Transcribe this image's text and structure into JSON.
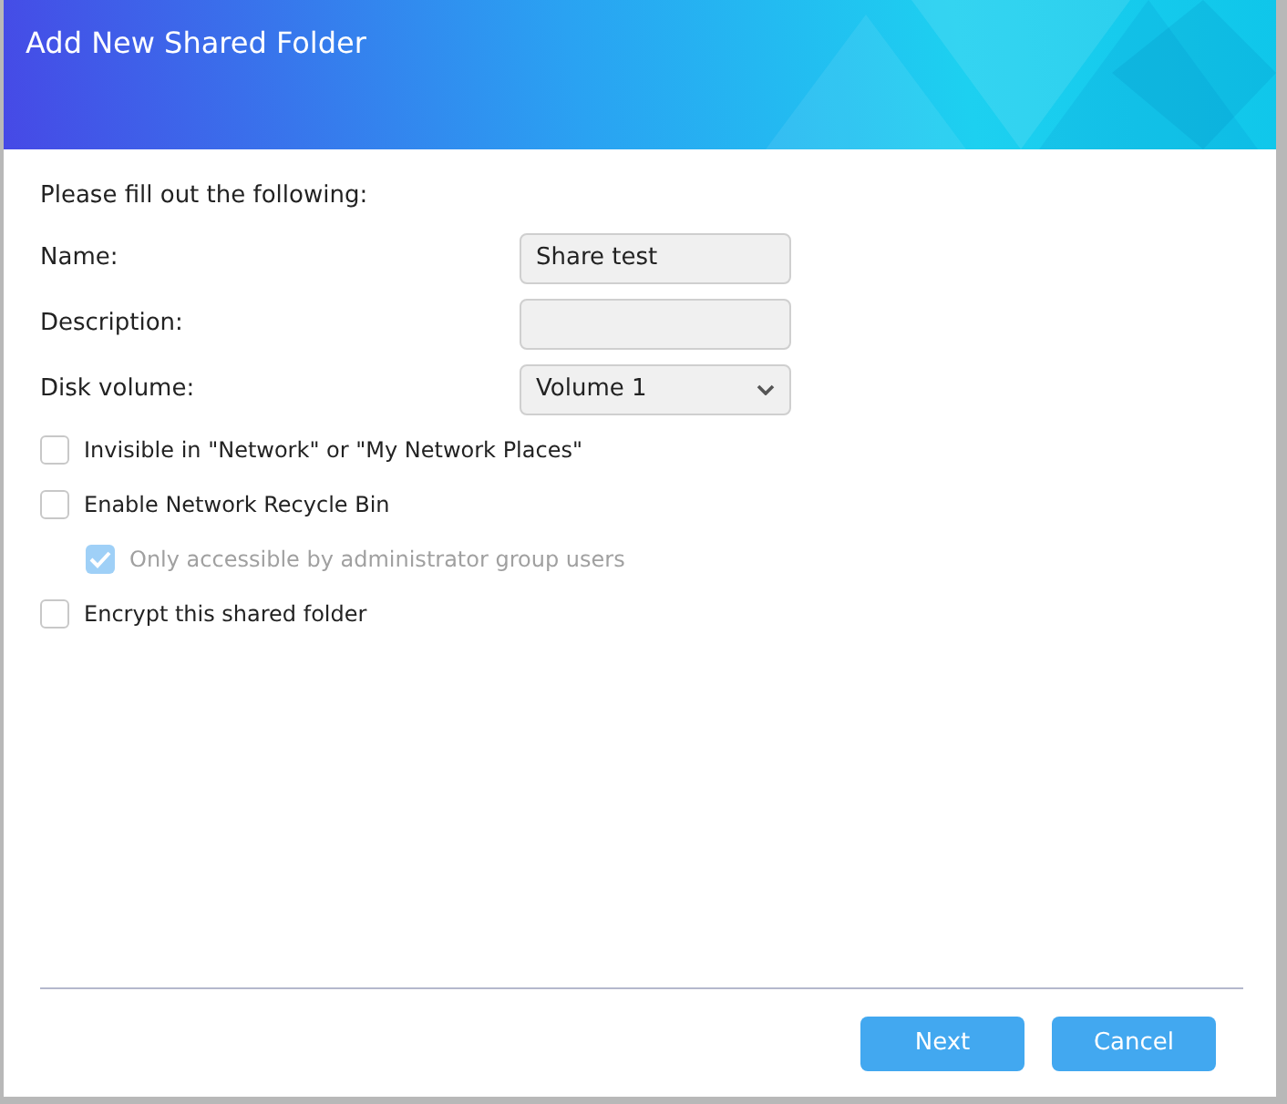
{
  "window": {
    "title": "Add New Shared Folder"
  },
  "intro": "Please fill out the following:",
  "fields": [
    {
      "kind": "text",
      "label": "Name:",
      "value": "Share test"
    },
    {
      "kind": "text",
      "label": "Description:"
    },
    {
      "kind": "select",
      "label": "Disk volume:",
      "value": "Volume 1"
    }
  ],
  "options": [
    {
      "label": "Invisible in \"Network\" or \"My Network Places\"",
      "checked": false,
      "disabled": false
    },
    {
      "label": "Enable Network Recycle Bin",
      "checked": false,
      "disabled": false,
      "children": [
        {
          "label": "Only accessible by administrator group users",
          "checked": true,
          "disabled": true
        }
      ]
    },
    {
      "label": "Encrypt this shared folder",
      "checked": false,
      "disabled": false
    }
  ],
  "buttons": [
    "Next",
    "Cancel"
  ]
}
